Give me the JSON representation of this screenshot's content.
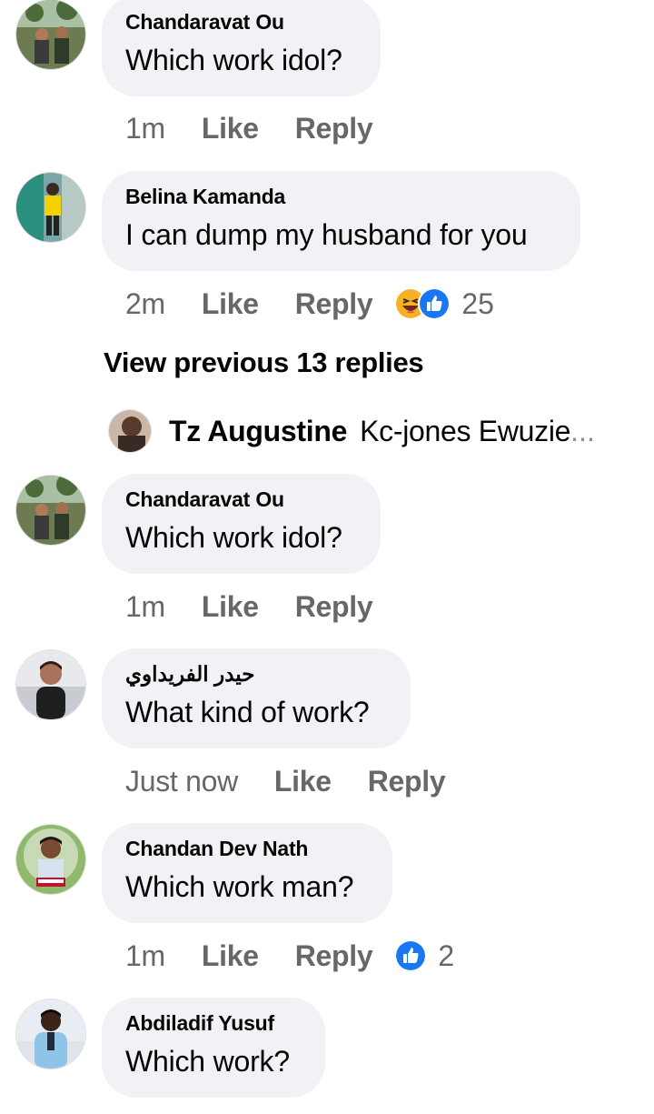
{
  "comments": [
    {
      "name": "Chandaravat Ou",
      "text": "Which work idol?",
      "time": "1m",
      "like": "Like",
      "reply": "Reply"
    },
    {
      "name": "Belina Kamanda",
      "text": "I can dump my husband for you",
      "time": "2m",
      "like": "Like",
      "reply": "Reply",
      "reaction_count": "25",
      "reactions": [
        "haha-icon",
        "like-icon"
      ]
    },
    {
      "name": "Chandaravat Ou",
      "text": "Which work idol?",
      "time": "1m",
      "like": "Like",
      "reply": "Reply"
    },
    {
      "name": "حيدر الفريداوي",
      "text": "What kind of work?",
      "time": "Just now",
      "like": "Like",
      "reply": "Reply"
    },
    {
      "name": "Chandan Dev Nath",
      "text": "Which work man?",
      "time": "1m",
      "like": "Like",
      "reply": "Reply",
      "reaction_count": "2",
      "reactions": [
        "like-icon"
      ]
    },
    {
      "name": "Abdiladif Yusuf",
      "text": "Which work?"
    }
  ],
  "view_previous": "View previous 13 replies",
  "reply_preview": {
    "author": "Tz Augustine",
    "snippet": "Kc-jones Ewuzie",
    "ellipsis": "..."
  },
  "colors": {
    "bubble": "#f0f2f5",
    "meta": "#65676b",
    "like_blue": "#1877f2",
    "haha_yellow": "#f7b125"
  }
}
